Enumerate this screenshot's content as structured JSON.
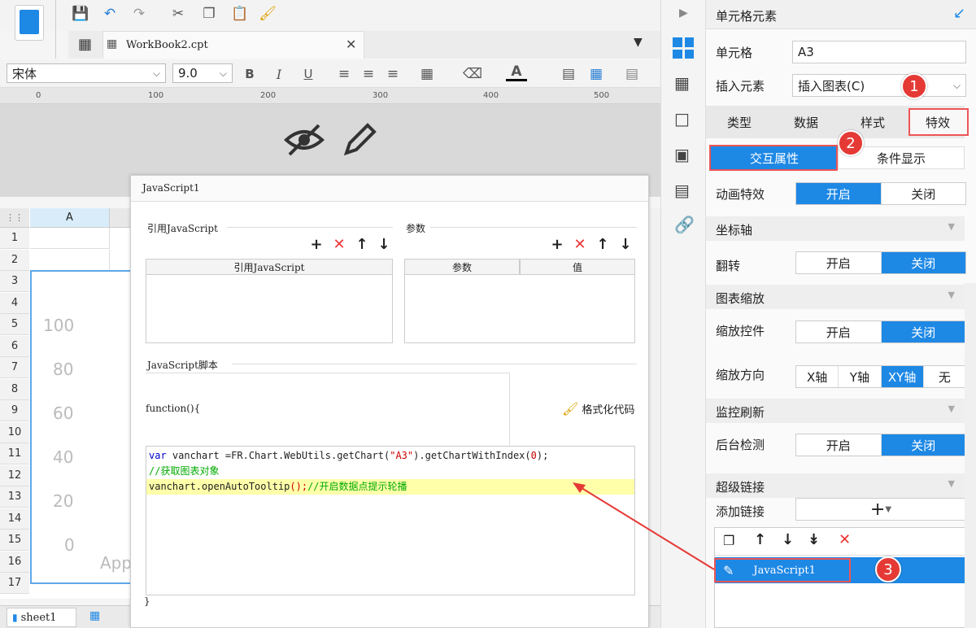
{
  "toolbar": {
    "tab_title": "WorkBook2.cpt",
    "font_name": "宋体",
    "font_size": "9.0",
    "bold": "B",
    "italic": "I",
    "underline": "U",
    "font_color": "A"
  },
  "ruler": {
    "ticks": [
      "0",
      "100",
      "200",
      "300",
      "400",
      "500"
    ]
  },
  "grid": {
    "col_a": "A",
    "rows": [
      "1",
      "2",
      "3",
      "4",
      "5",
      "6",
      "7",
      "8",
      "9",
      "10",
      "11",
      "12",
      "13",
      "14",
      "15",
      "16",
      "17"
    ],
    "y_labels": [
      "100",
      "80",
      "60",
      "40",
      "20",
      "0"
    ],
    "x_label": "App"
  },
  "status": {
    "sheet": "sheet1"
  },
  "dialog": {
    "title": "JavaScript1",
    "ref_js_label": "引用JavaScript",
    "params_label": "参数",
    "ref_js_col": "引用JavaScript",
    "param_col": "参数",
    "value_col": "值",
    "script_label": "JavaScript脚本",
    "function_head": "function(){",
    "format_btn": "格式化代码",
    "closing_brace": "}",
    "code": {
      "l1_kw": "var",
      "l1_a": " vanchart =FR.Chart.WebUtils.getChart(",
      "l1_str": "\"A3\"",
      "l1_b": ").getChartWithIndex(",
      "l1_num": "0",
      "l1_c": ");",
      "l2": "//获取图表对象",
      "l3_a": "vanchart.openAutoTooltip",
      "l3_b": "();",
      "l3_cmt": "//开启数据点提示轮播"
    }
  },
  "panel": {
    "header": "单元格元素",
    "cell_label": "单元格",
    "cell_value": "A3",
    "insert_label": "插入元素",
    "insert_value": "插入图表(C)",
    "tabs": [
      "类型",
      "数据",
      "样式",
      "特效"
    ],
    "sub_tabs": [
      "交互属性",
      "条件显示"
    ],
    "animation_label": "动画特效",
    "on": "开启",
    "off": "关闭",
    "axis_section": "坐标轴",
    "flip_label": "翻转",
    "zoom_section": "图表缩放",
    "zoom_control_label": "缩放控件",
    "zoom_dir_label": "缩放方向",
    "zoom_dirs": [
      "X轴",
      "Y轴",
      "XY轴",
      "无"
    ],
    "refresh_section": "监控刷新",
    "bg_check_label": "后台检测",
    "link_section": "超级链接",
    "add_link_label": "添加链接",
    "link_item": "JavaScript1"
  },
  "badges": [
    "1",
    "2",
    "3"
  ],
  "colors": {
    "accent": "#1e88e5",
    "badge": "#e53935",
    "highlight": "#ffffaa"
  }
}
